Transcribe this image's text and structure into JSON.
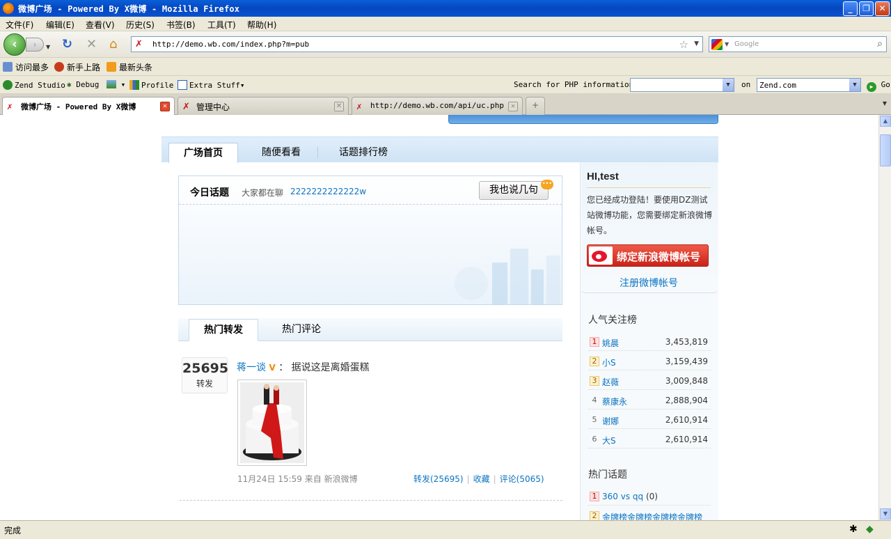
{
  "window": {
    "title": "微博广场 - Powered By X微博 - Mozilla Firefox"
  },
  "menu": {
    "items": [
      "文件(F)",
      "编辑(E)",
      "查看(V)",
      "历史(S)",
      "书签(B)",
      "工具(T)",
      "帮助(H)"
    ]
  },
  "nav": {
    "url": "http://demo.wb.com/index.php?m=pub",
    "search_placeholder": "Google"
  },
  "bookmarks": {
    "items": [
      "访问最多",
      "新手上路",
      "最新头条"
    ]
  },
  "zend": {
    "items": [
      "Zend Studio",
      "Debug",
      "Profile",
      "Extra Stuff"
    ],
    "search_label": "Search for PHP information:",
    "on_label": "on",
    "site_value": "Zend.com",
    "go_label": "Go"
  },
  "tabs": [
    {
      "title": "微博广场 - Powered By X微博",
      "active": true
    },
    {
      "title": "管理中心",
      "active": false
    },
    {
      "title": "http://demo.wb.com/api/uc.php",
      "active": false
    }
  ],
  "page": {
    "tabs": [
      "广场首页",
      "随便看看",
      "话题排行榜"
    ],
    "topic": {
      "title": "今日话题",
      "subtitle": "大家都在聊",
      "link": "2222222222222w",
      "button": "我也说几句",
      "bubble_icon": "comment-bubble-icon"
    },
    "hot_tabs": [
      "热门转发",
      "热门评论"
    ],
    "post": {
      "count": "25695",
      "count_label": "转发",
      "author": "蒋一谈",
      "verified": "V",
      "text": "据说这是离婚蛋糕",
      "meta": "11月24日 15:59 来自 新浪微博",
      "actions": [
        "转发(25695)",
        "收藏",
        "评论(5065)"
      ]
    },
    "sidebar": {
      "greeting": "HI,test",
      "message": "您已经成功登陆！要使用DZ测试站微博功能，您需要绑定新浪微博帐号。",
      "bind_button": "绑定新浪微博帐号",
      "register_link": "注册微博帐号",
      "popular_title": "人气关注榜",
      "popular": [
        {
          "rank": "1",
          "name": "姚晨",
          "value": "3,453,819"
        },
        {
          "rank": "2",
          "name": "小S",
          "value": "3,159,439"
        },
        {
          "rank": "3",
          "name": "赵薇",
          "value": "3,009,848"
        },
        {
          "rank": "4",
          "name": "蔡康永",
          "value": "2,888,904"
        },
        {
          "rank": "5",
          "name": "谢娜",
          "value": "2,610,914"
        },
        {
          "rank": "6",
          "name": "大S",
          "value": "2,610,914"
        }
      ],
      "topics_title": "热门话题",
      "topics": [
        {
          "rank": "1",
          "name": "360 vs qq",
          "count": "(0)"
        },
        {
          "rank": "2",
          "name": "金牌榜金牌榜金牌榜金牌榜",
          "count": ""
        }
      ]
    }
  },
  "status": {
    "text": "完成"
  }
}
